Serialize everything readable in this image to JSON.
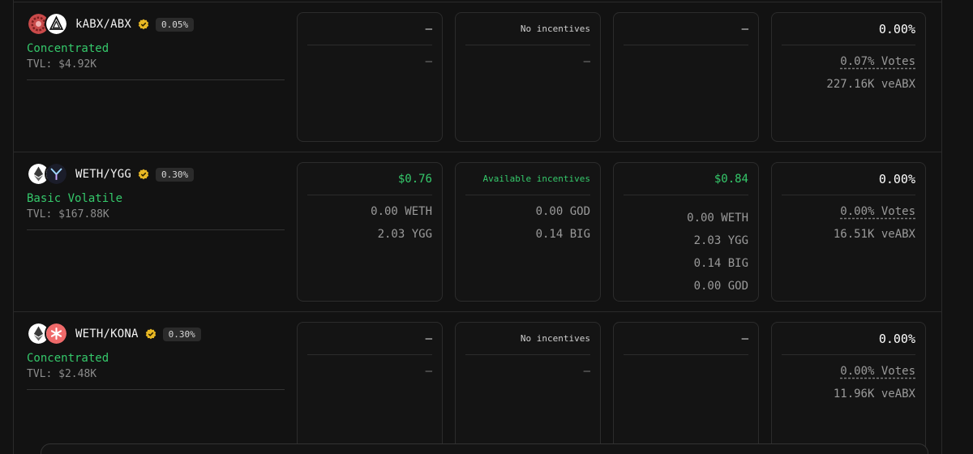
{
  "rows": [
    {
      "pair": "kABX/ABX",
      "fee": "0.05%",
      "type": "Concentrated",
      "tvl": "TVL: $4.92K",
      "token_icons": [
        "kabx-token-icon",
        "abx-token-icon"
      ],
      "col1": {
        "head": "–",
        "lines": [
          "–"
        ]
      },
      "col2": {
        "head": "No incentives",
        "lines": [
          "–"
        ]
      },
      "col3": {
        "head": "–",
        "lines": []
      },
      "col4": {
        "head": "0.00%",
        "votes": "0.07% Votes",
        "ve": "227.16K veABX"
      }
    },
    {
      "pair": "WETH/YGG",
      "fee": "0.30%",
      "type": "Basic Volatile",
      "tvl": "TVL: $167.88K",
      "token_icons": [
        "weth-token-icon",
        "ygg-token-icon"
      ],
      "col1": {
        "head": "$0.76",
        "lines": [
          "0.00 WETH",
          "2.03 YGG"
        ]
      },
      "col2": {
        "head": "Available incentives",
        "lines": [
          "0.00 GOD",
          "0.14 BIG"
        ]
      },
      "col3": {
        "head": "$0.84",
        "lines": [
          "0.00 WETH",
          "2.03 YGG",
          "0.14 BIG",
          "0.00 GOD"
        ]
      },
      "col4": {
        "head": "0.00%",
        "votes": "0.00% Votes",
        "ve": "16.51K veABX"
      }
    },
    {
      "pair": "WETH/KONA",
      "fee": "0.30%",
      "type": "Concentrated",
      "tvl": "TVL: $2.48K",
      "token_icons": [
        "weth-token-icon",
        "kona-token-icon"
      ],
      "col1": {
        "head": "–",
        "lines": [
          "–"
        ]
      },
      "col2": {
        "head": "No incentives",
        "lines": [
          "–"
        ]
      },
      "col3": {
        "head": "–",
        "lines": []
      },
      "col4": {
        "head": "0.00%",
        "votes": "0.00% Votes",
        "ve": "11.96K veABX"
      }
    }
  ],
  "icons": {
    "verified": "verified-badge-icon"
  },
  "colors": {
    "green": "#35c96b",
    "background": "#121212",
    "border": "#2c2c2c"
  }
}
